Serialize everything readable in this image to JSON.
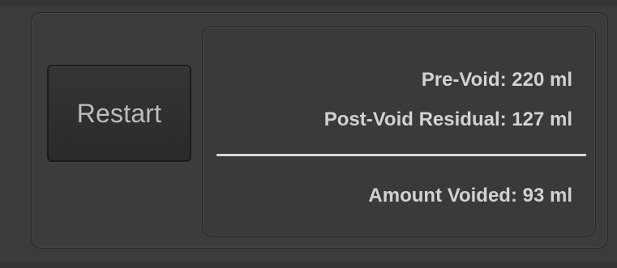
{
  "controls": {
    "restart_label": "Restart"
  },
  "results": {
    "pre_void": "Pre-Void: 220 ml",
    "post_void_residual": "Post-Void Residual: 127 ml",
    "amount_voided": "Amount Voided: 93 ml"
  },
  "colors": {
    "background": "#3b3b3b",
    "panel_border": "#262626",
    "text": "#d2d2d2",
    "divider": "#d8d8d8"
  }
}
